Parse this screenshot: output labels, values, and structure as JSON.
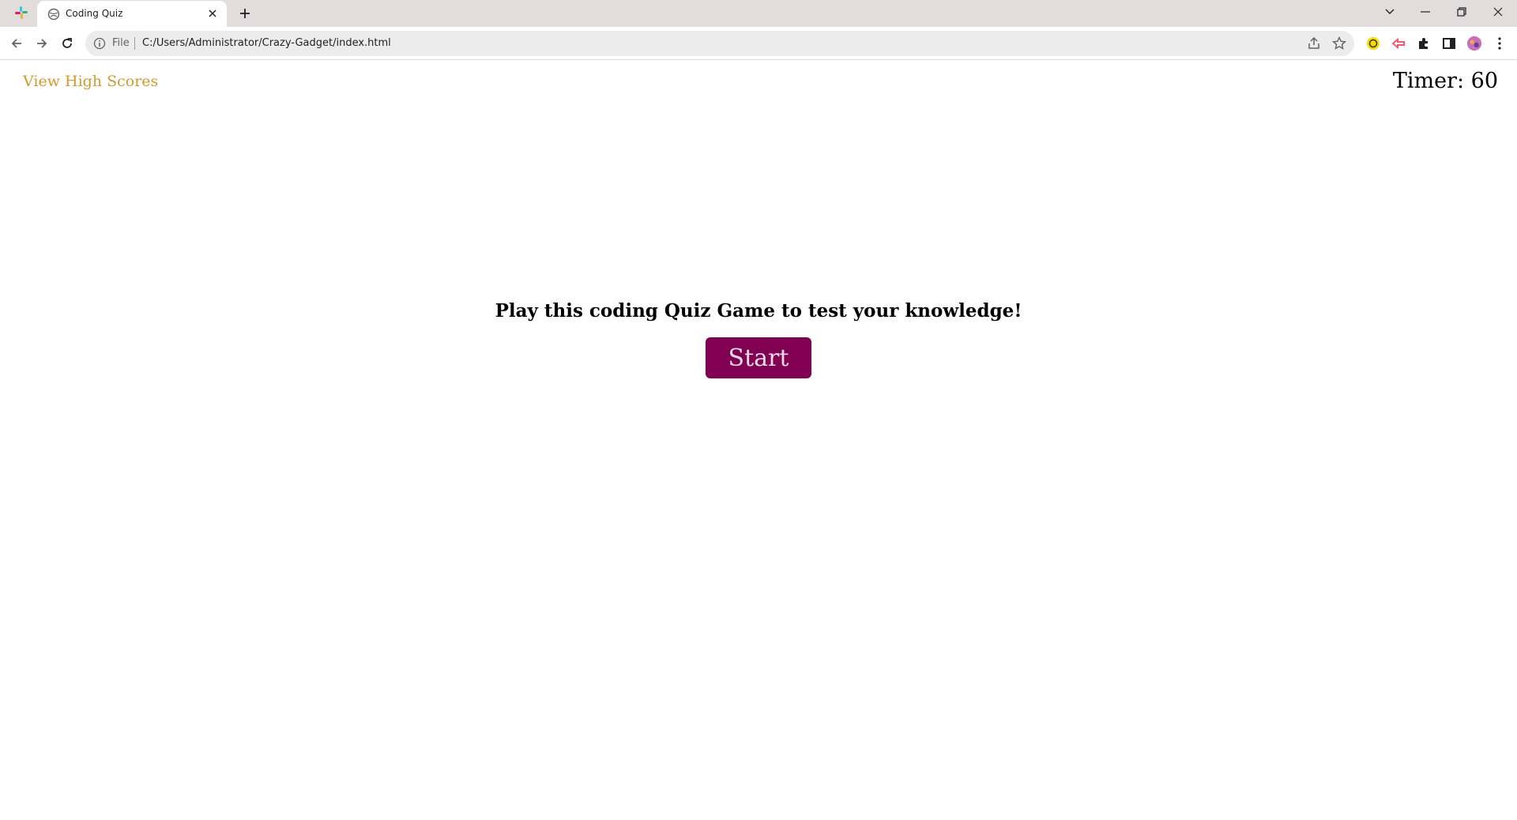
{
  "browser": {
    "tab": {
      "title": "Coding Quiz"
    },
    "address_bar": {
      "scheme_label": "File",
      "url": "C:/Users/Administrator/Crazy-Gadget/index.html"
    }
  },
  "page": {
    "high_scores_link": "View High Scores",
    "timer": "Timer: 60",
    "intro_text": "Play this coding Quiz Game to test your knowledge!",
    "start_button": "Start"
  },
  "colors": {
    "link": "#d29a2c",
    "start_button_bg": "#810052",
    "tab_strip_bg": "#e2dcdc"
  },
  "icons": [
    "slack-icon",
    "globe-favicon-icon",
    "close-tab-icon",
    "new-tab-icon",
    "tab-search-icon",
    "minimize-icon",
    "restore-icon",
    "close-window-icon",
    "back-icon",
    "forward-icon",
    "reload-icon",
    "info-icon",
    "share-icon",
    "bookmark-star-icon",
    "extension-yellow-icon",
    "extension-red-icon",
    "extensions-puzzle-icon",
    "side-panel-icon",
    "profile-avatar-icon",
    "menu-kebab-icon"
  ]
}
